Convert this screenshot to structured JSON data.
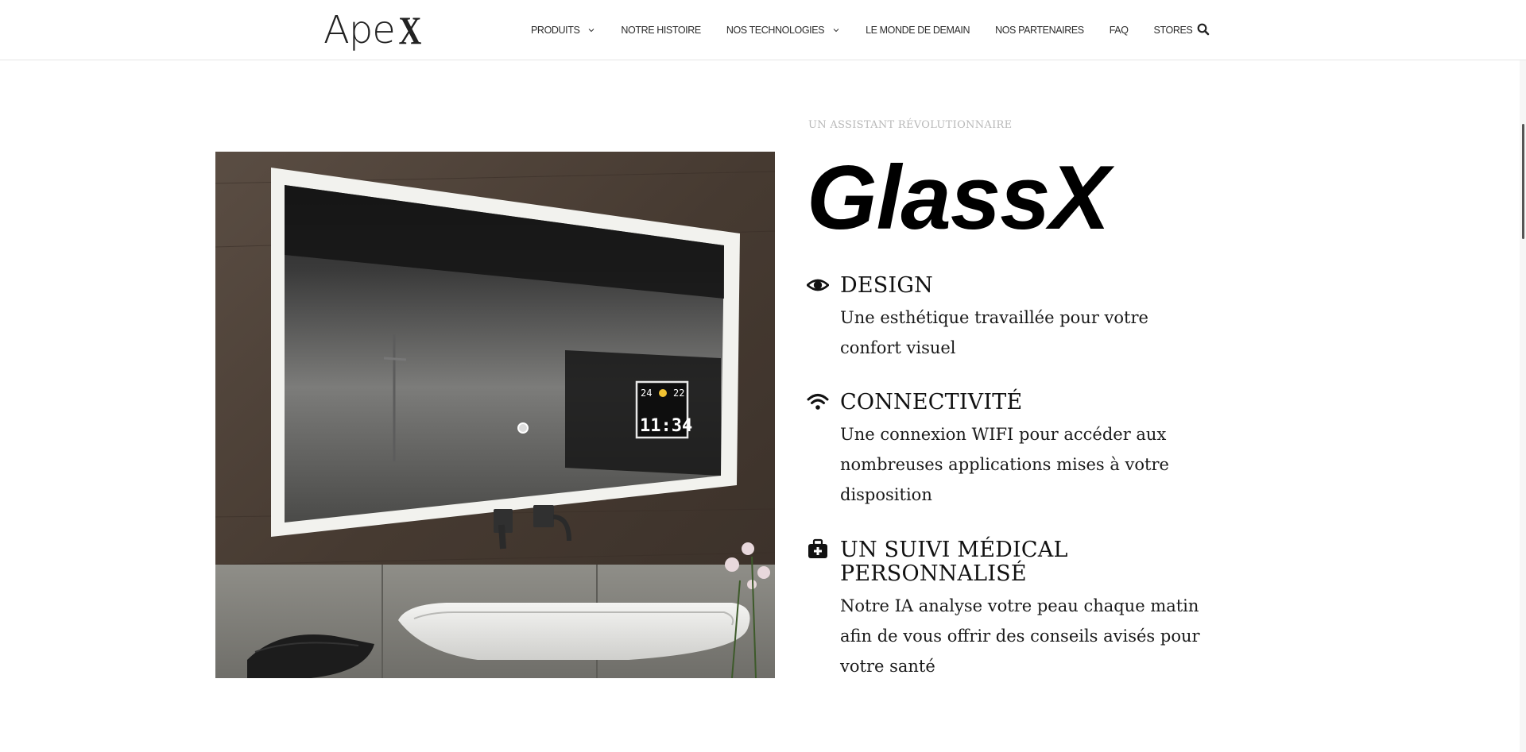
{
  "header": {
    "logo": {
      "text": "Ape",
      "mark": "X"
    },
    "nav": [
      {
        "label": "PRODUITS",
        "has_dropdown": true
      },
      {
        "label": "NOTRE HISTOIRE",
        "has_dropdown": false
      },
      {
        "label": "NOS TECHNOLOGIES",
        "has_dropdown": true
      },
      {
        "label": "LE MONDE DE DEMAIN",
        "has_dropdown": false
      },
      {
        "label": "NOS PARTENAIRES",
        "has_dropdown": false
      },
      {
        "label": "FAQ",
        "has_dropdown": false
      },
      {
        "label": "STORES",
        "has_dropdown": false
      }
    ],
    "search_icon": "search-icon"
  },
  "hero": {
    "kicker": "UN ASSISTANT RÉVOLUTIONNAIRE",
    "title": "GlassX",
    "image": {
      "mirror_display": {
        "temp_left": "24",
        "temp_right": "22",
        "time": "11:34"
      }
    }
  },
  "features": [
    {
      "icon": "eye-icon",
      "title": "DESIGN",
      "description": "Une esthétique travaillée pour votre confort visuel"
    },
    {
      "icon": "wifi-icon",
      "title": "CONNECTIVITÉ",
      "description": "Une connexion WIFI pour accéder aux nombreuses applications mises à votre disposition"
    },
    {
      "icon": "medkit-icon",
      "title": "UN SUIVI MÉDICAL PERSONNALISÉ",
      "description": "Notre IA analyse votre peau chaque matin afin de vous offrir des conseils avisés pour votre santé"
    }
  ]
}
